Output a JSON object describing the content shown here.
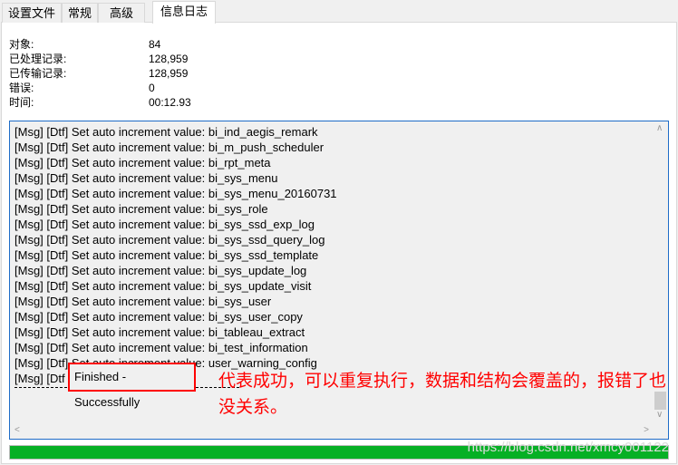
{
  "tabs": [
    "设置文件",
    "常规",
    "高级",
    "信息日志"
  ],
  "stats": [
    {
      "label": "对象:",
      "value": "84"
    },
    {
      "label": "已处理记录:",
      "value": "128,959"
    },
    {
      "label": "已传输记录:",
      "value": "128,959"
    },
    {
      "label": "错误:",
      "value": "0"
    },
    {
      "label": "时间:",
      "value": "00:12.93"
    }
  ],
  "log": [
    "[Msg] [Dtf] Set auto increment value: bi_ind_aegis_remark",
    "[Msg] [Dtf] Set auto increment value: bi_m_push_scheduler",
    "[Msg] [Dtf] Set auto increment value: bi_rpt_meta",
    "[Msg] [Dtf] Set auto increment value: bi_sys_menu",
    "[Msg] [Dtf] Set auto increment value: bi_sys_menu_20160731",
    "[Msg] [Dtf] Set auto increment value: bi_sys_role",
    "[Msg] [Dtf] Set auto increment value: bi_sys_ssd_exp_log",
    "[Msg] [Dtf] Set auto increment value: bi_sys_ssd_query_log",
    "[Msg] [Dtf] Set auto increment value: bi_sys_ssd_template",
    "[Msg] [Dtf] Set auto increment value: bi_sys_update_log",
    "[Msg] [Dtf] Set auto increment value: bi_sys_update_visit",
    "[Msg] [Dtf] Set auto increment value: bi_sys_user",
    "[Msg] [Dtf] Set auto increment value: bi_sys_user_copy",
    "[Msg] [Dtf] Set auto increment value: bi_tableau_extract",
    "[Msg] [Dtf] Set auto increment value: bi_test_information",
    "[Msg] [Dtf] Set auto increment value: user_warning_config",
    "[Msg] [Dtf"
  ],
  "finished": "Finished - Successfully",
  "annotation": "代表成功，可以重复执行，数据和结构会覆盖的，报错了也没关系。",
  "progress_percent": 100,
  "watermark": "https://blog.csdn.net/xmcy001122",
  "colors": {
    "progress": "#06b025",
    "annotation": "#ff0000",
    "log_border": "#1e6cc7"
  }
}
